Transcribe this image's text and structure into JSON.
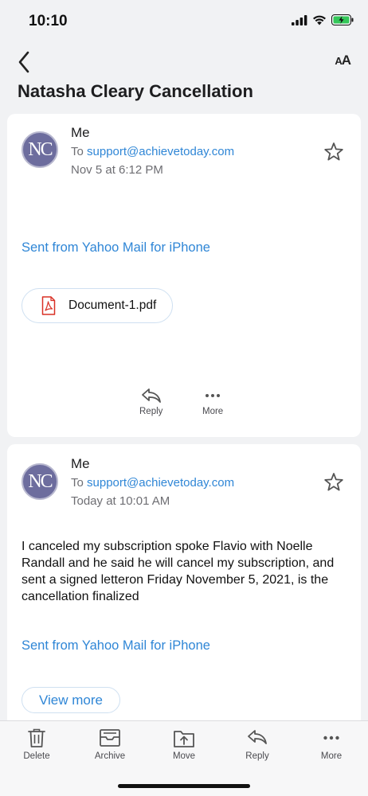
{
  "status": {
    "time": "10:10"
  },
  "nav": {
    "text_size_label_small": "A",
    "text_size_label_large": "A"
  },
  "thread": {
    "title": "Natasha Cleary Cancellation"
  },
  "messages": [
    {
      "avatar_initials": "NC",
      "sender": "Me",
      "to_prefix": "To",
      "to_email": "support@achievetoday.com",
      "date": "Nov 5 at 6:12 PM",
      "signature": "Sent from Yahoo Mail for iPhone",
      "attachment": {
        "name": "Document-1.pdf",
        "icon": "pdf-icon"
      },
      "actions": {
        "reply": "Reply",
        "more": "More"
      }
    },
    {
      "avatar_initials": "NC",
      "sender": "Me",
      "to_prefix": "To",
      "to_email": "support@achievetoday.com",
      "date": "Today at 10:01 AM",
      "body": "I canceled my subscription spoke Flavio with Noelle Randall and he said he will cancel my subscription, and sent a signed letteron Friday November 5, 2021,  is the cancellation finalized",
      "signature": "Sent from Yahoo Mail for iPhone",
      "view_more": "View more"
    }
  ],
  "toolbar": {
    "delete": "Delete",
    "archive": "Archive",
    "move": "Move",
    "reply": "Reply",
    "more": "More"
  },
  "colors": {
    "link": "#2f86d6",
    "pdf": "#d93025",
    "battery": "#34c759"
  }
}
